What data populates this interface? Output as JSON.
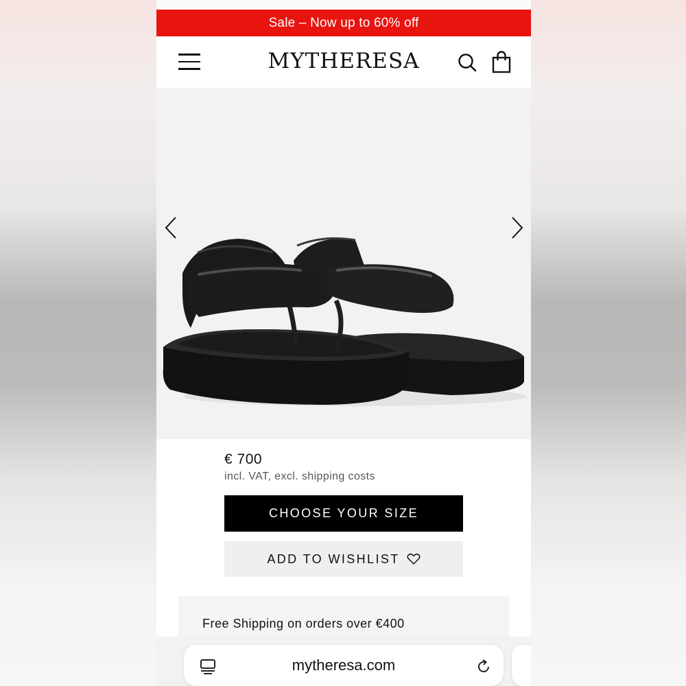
{
  "banner": {
    "text": "Sale – Now up to 60% off"
  },
  "header": {
    "logo": "MYTHERESA",
    "menu_icon": "hamburger-menu-icon",
    "search_icon": "search-icon",
    "bag_icon": "shopping-bag-icon"
  },
  "gallery": {
    "prev_icon": "chevron-left-icon",
    "next_icon": "chevron-right-icon",
    "image": "black padded platform thong sandals"
  },
  "product": {
    "price": "€ 700",
    "vat_note": "incl. VAT, excl. shipping costs",
    "choose_size_label": "CHOOSE YOUR SIZE",
    "wishlist_label": "ADD TO WISHLIST",
    "wishlist_icon": "heart-icon"
  },
  "shipping": {
    "text": "Free Shipping on orders over €400"
  },
  "browser": {
    "url": "mytheresa.com",
    "tabs_icon": "tabs-icon",
    "reload_icon": "reload-icon"
  },
  "colors": {
    "banner_bg": "#e8140f",
    "primary_button": "#000000",
    "secondary_button": "#efefef",
    "gallery_bg": "#f2f2f2"
  }
}
